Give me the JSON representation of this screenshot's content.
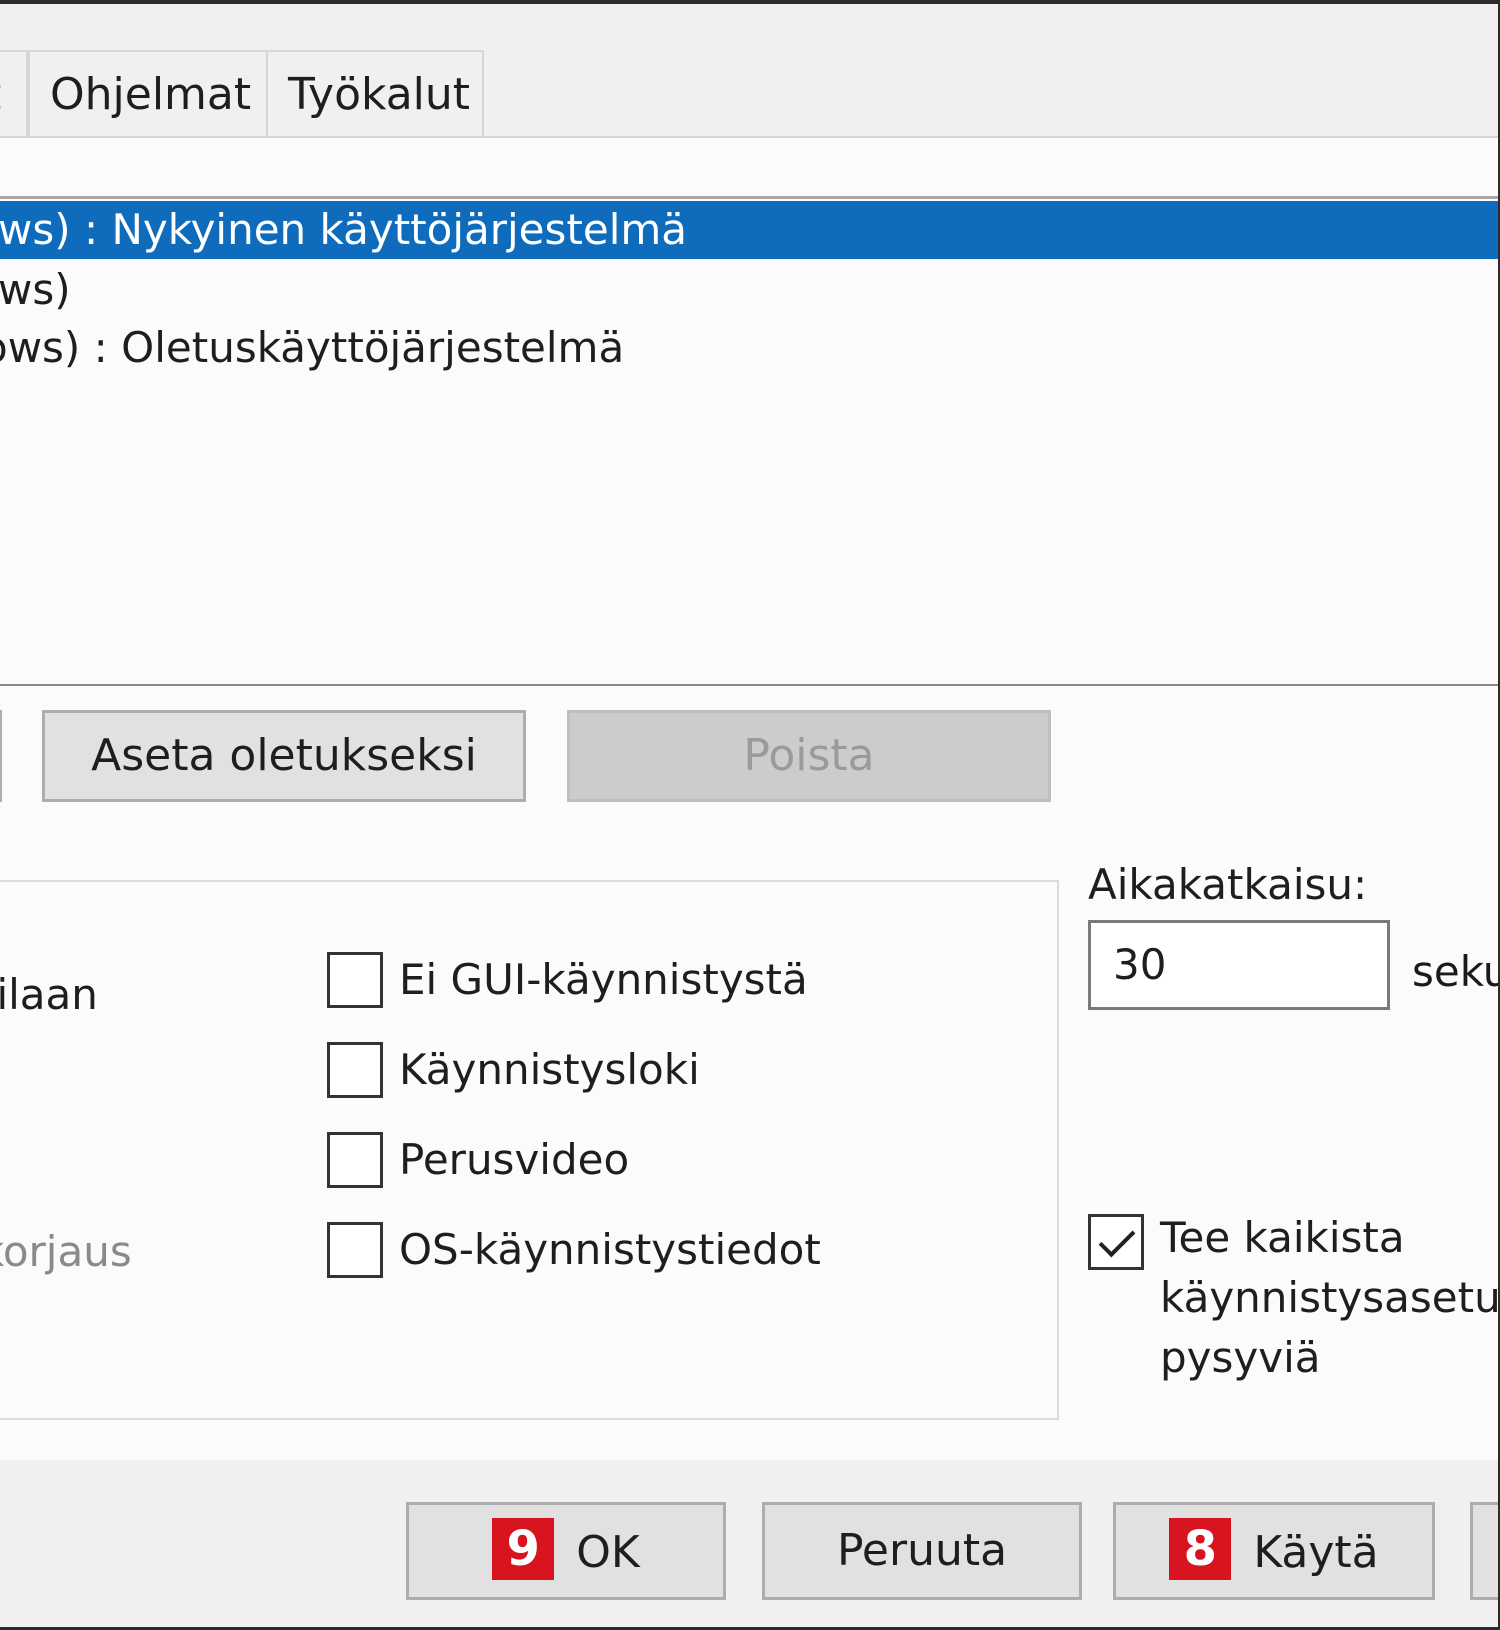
{
  "tabs": {
    "partial": "t",
    "programs": "Ohjelmat",
    "tools": "Työkalut"
  },
  "os_list": [
    {
      "label": "ws) : Nykyinen käyttöjärjestelmä",
      "selected": true
    },
    {
      "label": "ws)",
      "selected": false
    },
    {
      "label": "ows) : Oletuskäyttöjärjestelmä",
      "selected": false
    }
  ],
  "buttons": {
    "set_default": "Aseta oletukseksi",
    "delete": "Poista"
  },
  "boot_options": {
    "partial_left_1": "tilaan",
    "partial_left_2": "korjaus",
    "no_gui": "Ei GUI-käynnistystä",
    "boot_log": "Käynnistysloki",
    "base_video": "Perusvideo",
    "os_boot_info": "OS-käynnistystiedot"
  },
  "timeout": {
    "label": "Aikakatkaisu:",
    "value": "30",
    "unit": "seku"
  },
  "persist": {
    "line1": "Tee kaikista",
    "line2": "käynnistysasetu",
    "line3": "pysyviä",
    "checked": true
  },
  "footer": {
    "ok_badge": "9",
    "ok": "OK",
    "cancel": "Peruuta",
    "apply_badge": "8",
    "apply": "Käytä"
  },
  "colors": {
    "selection": "#0f6cbd",
    "badge": "#d7141f"
  }
}
